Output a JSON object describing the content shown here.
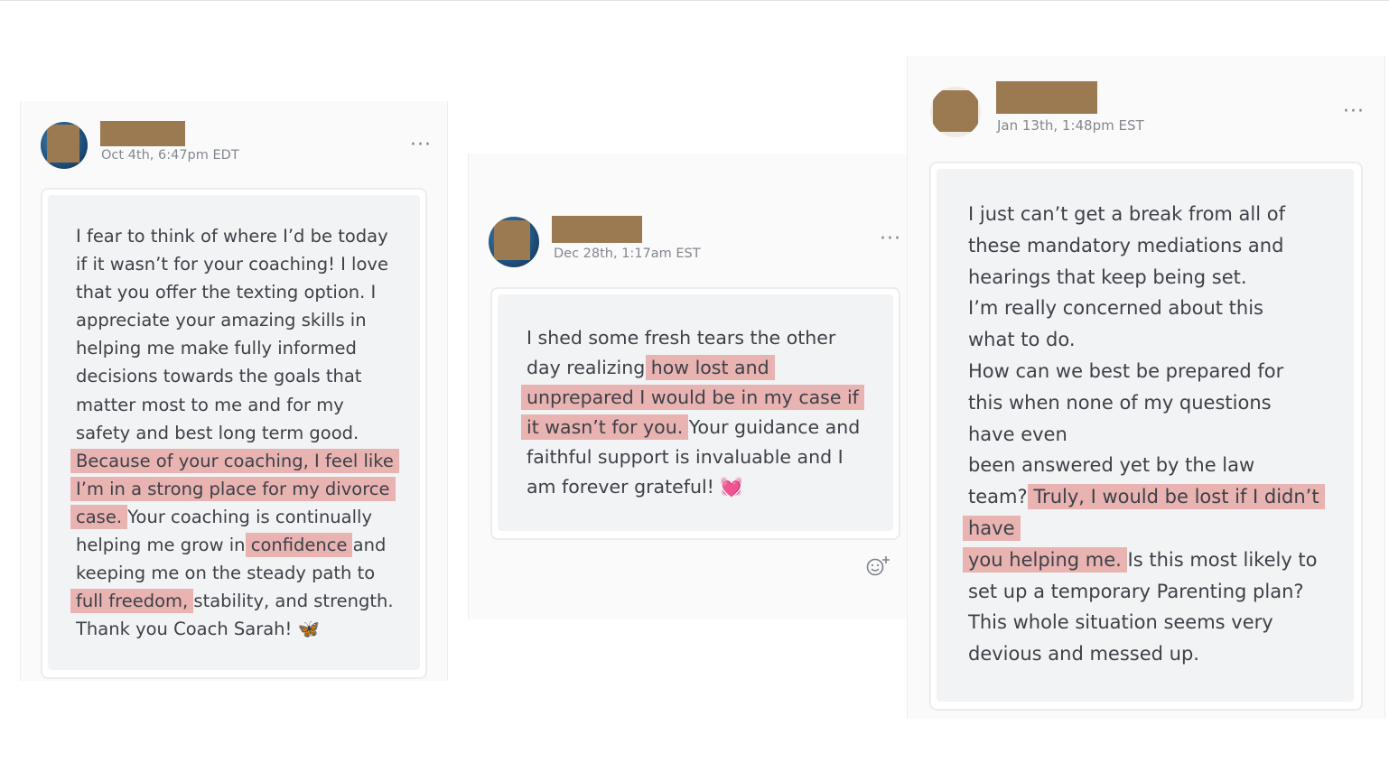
{
  "posts": [
    {
      "timestamp": "Oct 4th, 6:47pm EDT",
      "more_icon": "···",
      "message_lines": [
        {
          "parts": [
            {
              "text": "I fear to think of where I’d be today"
            }
          ]
        },
        {
          "parts": [
            {
              "text": "if it wasn’t for your coaching! I love"
            }
          ]
        },
        {
          "parts": [
            {
              "text": "that you offer the texting option. I"
            }
          ]
        },
        {
          "parts": [
            {
              "text": "appreciate your amazing skills in"
            }
          ]
        },
        {
          "parts": [
            {
              "text": "helping me make fully informed"
            }
          ]
        },
        {
          "parts": [
            {
              "text": "decisions towards the goals that"
            }
          ]
        },
        {
          "parts": [
            {
              "text": "matter most to me and for my"
            }
          ]
        },
        {
          "parts": [
            {
              "text": "safety and best long term good."
            }
          ]
        },
        {
          "parts": [
            {
              "text": "Because of your coaching, I feel like",
              "highlight": true
            }
          ]
        },
        {
          "parts": [
            {
              "text": "I’m in a strong place for my divorce",
              "highlight": true
            }
          ]
        },
        {
          "parts": [
            {
              "text": "case.",
              "highlight": true
            },
            {
              "text": " Your coaching is continually"
            }
          ]
        },
        {
          "parts": [
            {
              "text": "helping me grow in "
            },
            {
              "text": "confidence",
              "highlight": true
            },
            {
              "text": " and"
            }
          ]
        },
        {
          "parts": [
            {
              "text": "keeping me on the steady path to"
            }
          ]
        },
        {
          "parts": [
            {
              "text": "full freedom,",
              "highlight": true
            },
            {
              "text": " stability, and strength."
            }
          ]
        },
        {
          "parts": [
            {
              "text": "Thank you Coach Sarah! 🦋"
            }
          ]
        }
      ]
    },
    {
      "timestamp": "Dec 28th, 1:17am EST",
      "more_icon": "···",
      "emoji_icon": "☺⁺",
      "message_lines": [
        {
          "parts": [
            {
              "text": "I shed some fresh tears the other"
            }
          ]
        },
        {
          "parts": [
            {
              "text": "day realizing "
            },
            {
              "text": "how lost and",
              "highlight": true
            }
          ]
        },
        {
          "parts": [
            {
              "text": "unprepared I would be in my case if",
              "highlight": true
            }
          ]
        },
        {
          "parts": [
            {
              "text": "it wasn’t for you.",
              "highlight": true
            },
            {
              "text": " Your guidance and"
            }
          ]
        },
        {
          "parts": [
            {
              "text": "faithful support is invaluable and I"
            }
          ]
        },
        {
          "parts": [
            {
              "text": "am forever grateful! 💓"
            }
          ]
        }
      ]
    },
    {
      "timestamp": "Jan 13th, 1:48pm EST",
      "more_icon": "···",
      "message_lines": [
        {
          "parts": [
            {
              "text": "I just can’t get a break from all of"
            }
          ]
        },
        {
          "parts": [
            {
              "text": "these mandatory mediations and"
            }
          ]
        },
        {
          "parts": [
            {
              "text": "hearings that keep being set."
            }
          ]
        },
        {
          "parts": [
            {
              "text": "I’m really concerned about this"
            }
          ]
        },
        {
          "parts": [
            {
              "text": "what to do."
            }
          ]
        },
        {
          "parts": [
            {
              "text": "How can we best be prepared for"
            }
          ]
        },
        {
          "parts": [
            {
              "text": "this when none of my questions"
            }
          ]
        },
        {
          "parts": [
            {
              "text": "have even"
            }
          ]
        },
        {
          "parts": [
            {
              "text": "been answered yet by the law"
            }
          ]
        },
        {
          "parts": [
            {
              "text": "team? "
            },
            {
              "text": "Truly, I would be lost if I didn’t",
              "highlight": true
            }
          ]
        },
        {
          "parts": [
            {
              "text": "have",
              "highlight": true
            }
          ]
        },
        {
          "parts": [
            {
              "text": "you helping me.",
              "highlight": true
            },
            {
              "text": " Is this most likely to"
            }
          ]
        },
        {
          "parts": [
            {
              "text": "set up a temporary Parenting plan?"
            }
          ]
        },
        {
          "parts": [
            {
              "text": "This whole situation seems very"
            }
          ]
        },
        {
          "parts": [
            {
              "text": "devious and messed up."
            }
          ]
        }
      ]
    }
  ],
  "colors": {
    "highlight": "#e8b3b1",
    "redaction": "#9b7a52",
    "bubble": "#f1f3f4",
    "text": "#3d4148",
    "timestamp": "#83878e"
  }
}
